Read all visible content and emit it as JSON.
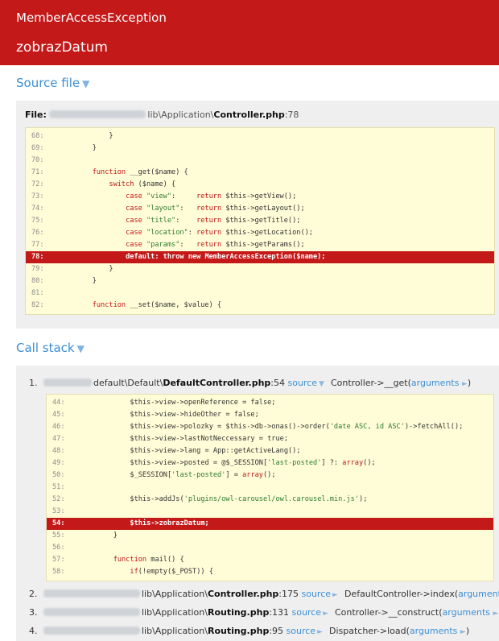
{
  "header": {
    "exception": "MemberAccessException",
    "message": "zobrazDatum"
  },
  "source_file": {
    "title": "Source file",
    "toggle": "▼",
    "file_label": "File:",
    "path_mid": "lib\\Application\\",
    "file_name": "Controller.php",
    "line": ":78",
    "code": [
      {
        "n": "68:",
        "t": "        }"
      },
      {
        "n": "69:",
        "t": "    }"
      },
      {
        "n": "70:",
        "t": ""
      },
      {
        "n": "71:",
        "t": "    function __get($name) {"
      },
      {
        "n": "72:",
        "t": "        switch ($name) {"
      },
      {
        "n": "73:",
        "t": "            case \"view\":     return $this->getView();"
      },
      {
        "n": "74:",
        "t": "            case \"layout\":   return $this->getLayout();"
      },
      {
        "n": "75:",
        "t": "            case \"title\":    return $this->getTitle();"
      },
      {
        "n": "76:",
        "t": "            case \"location\": return $this->getLocation();"
      },
      {
        "n": "77:",
        "t": "            case \"params\":   return $this->getParams();"
      },
      {
        "n": "78:",
        "t": "            default: throw new MemberAccessException($name);",
        "hl": true
      },
      {
        "n": "79:",
        "t": "        }"
      },
      {
        "n": "80:",
        "t": "    }"
      },
      {
        "n": "81:",
        "t": ""
      },
      {
        "n": "82:",
        "t": "    function __set($name, $value) {"
      }
    ]
  },
  "call_stack": {
    "title": "Call stack",
    "toggle": "▼",
    "items": [
      {
        "idx": "1.",
        "path_mid": "default\\Default\\",
        "file": "DefaultController.php",
        "line": ":54",
        "source": "source",
        "arrow": "▼",
        "call": "Controller->__get(",
        "args": "arguments",
        "args_arrow": "►",
        "close": ")"
      },
      {
        "idx": "2.",
        "path_mid": "lib\\Application\\",
        "file": "Controller.php",
        "line": ":175",
        "source": "source",
        "arrow": "►",
        "call": "DefaultController->index(",
        "args": "arguments",
        "args_arrow": "►",
        "close": ")"
      },
      {
        "idx": "3.",
        "path_mid": "lib\\Application\\",
        "file": "Routing.php",
        "line": ":131",
        "source": "source",
        "arrow": "►",
        "call": "Controller->__construct(",
        "args": "arguments",
        "args_arrow": "►",
        "close": ")"
      },
      {
        "idx": "4.",
        "path_mid": "lib\\Application\\",
        "file": "Routing.php",
        "line": ":95",
        "source": "source",
        "arrow": "►",
        "call": "Dispatcher->load(",
        "args": "arguments",
        "args_arrow": "►",
        "close": ")"
      }
    ],
    "code": [
      {
        "n": "44:",
        "t": "        $this->view->openReference = false;"
      },
      {
        "n": "45:",
        "t": "        $this->view->hideOther = false;"
      },
      {
        "n": "46:",
        "t": "        $this->view->polozky = $this->db->onas()->order('date ASC, id ASC')->fetchAll();"
      },
      {
        "n": "47:",
        "t": "        $this->view->lastNotNeccessary = true;"
      },
      {
        "n": "48:",
        "t": "        $this->view->lang = App::getActiveLang();"
      },
      {
        "n": "49:",
        "t": "        $this->view->posted = @$_SESSION['last-posted'] ?: array();"
      },
      {
        "n": "50:",
        "t": "        $_SESSION['last-posted'] = array();"
      },
      {
        "n": "51:",
        "t": ""
      },
      {
        "n": "52:",
        "t": "        $this->addJs('plugins/owl-carousel/owl.carousel.min.js');"
      },
      {
        "n": "53:",
        "t": ""
      },
      {
        "n": "54:",
        "t": "        $this->zobrazDatum;",
        "hl": true
      },
      {
        "n": "55:",
        "t": "    }"
      },
      {
        "n": "56:",
        "t": ""
      },
      {
        "n": "57:",
        "t": "    function mail() {"
      },
      {
        "n": "58:",
        "t": "        if(!empty($_POST)) {"
      }
    ]
  }
}
